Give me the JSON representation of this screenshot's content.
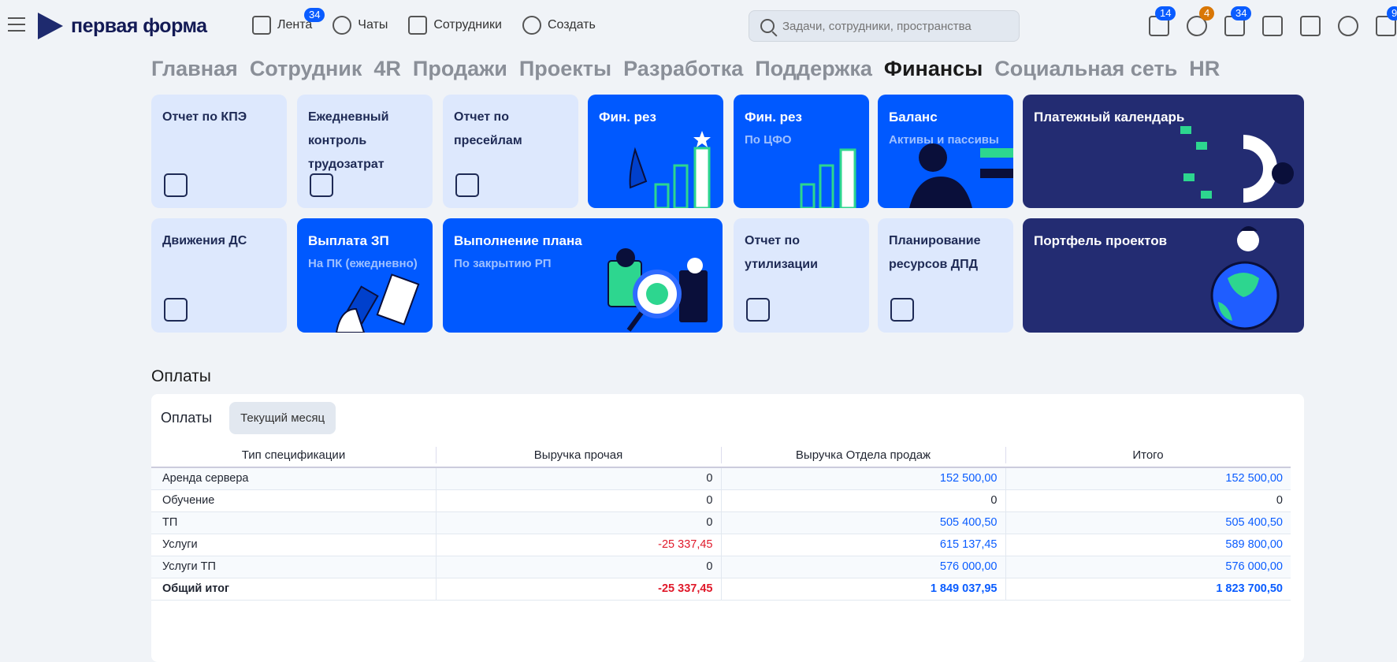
{
  "header": {
    "logo": "первая форма",
    "nav": [
      {
        "label": "Лента",
        "badge": "34"
      },
      {
        "label": "Чаты"
      },
      {
        "label": "Сотрудники"
      },
      {
        "label": "Создать"
      }
    ],
    "search_placeholder": "Задачи, сотрудники, пространства",
    "right_badges": {
      "tasks": "14",
      "favorites": "4",
      "mail": "34",
      "calendar": "9"
    }
  },
  "tabs": [
    "Главная",
    "Сотрудник",
    "4R",
    "Продажи",
    "Проекты",
    "Разработка",
    "Поддержка",
    "Финансы",
    "Социальная сеть",
    "HR"
  ],
  "active_tab": "Финансы",
  "tiles": {
    "kpe": "Отчет по КПЭ",
    "daily": "Ежедневный контроль трудозатрат",
    "presale": "Отчет по пресейлам",
    "finres": "Фин. рез",
    "finres_cfo": "Фин. рез",
    "finres_cfo_sub": "По ЦФО",
    "balance": "Баланс",
    "balance_sub": "Активы и пассивы",
    "paycal": "Платежный календарь",
    "cashflow": "Движения ДС",
    "salary": "Выплата ЗП",
    "salary_sub": "На ПК (ежедневно)",
    "plan": "Выполнение плана",
    "plan_sub": "По закрытию РП",
    "util": "Отчет по утилизации",
    "resplan": "Планирование ресурсов ДПД",
    "portfolio": "Портфель проектов"
  },
  "payments": {
    "title": "Оплаты",
    "tab": "Оплаты",
    "filter": "Текущий месяц",
    "columns": [
      "Тип спецификации",
      "Выручка прочая",
      "Выручка Отдела продаж",
      "Итого"
    ],
    "rows": [
      [
        "Аренда сервера",
        "0",
        "152 500,00",
        "152 500,00"
      ],
      [
        "Обучение",
        "0",
        "0",
        "0"
      ],
      [
        "ТП",
        "0",
        "505 400,50",
        "505 400,50"
      ],
      [
        "Услуги",
        "-25 337,45",
        "615 137,45",
        "589 800,00"
      ],
      [
        "Услуги ТП",
        "0",
        "576 000,00",
        "576 000,00"
      ]
    ],
    "total": [
      "Общий итог",
      "-25 337,45",
      "1 849 037,95",
      "1 823 700,50"
    ]
  },
  "colors": {
    "accent": "#0059ff",
    "navy": "#232c72",
    "light_tile": "#dde8fd",
    "negative": "#e0192a"
  }
}
